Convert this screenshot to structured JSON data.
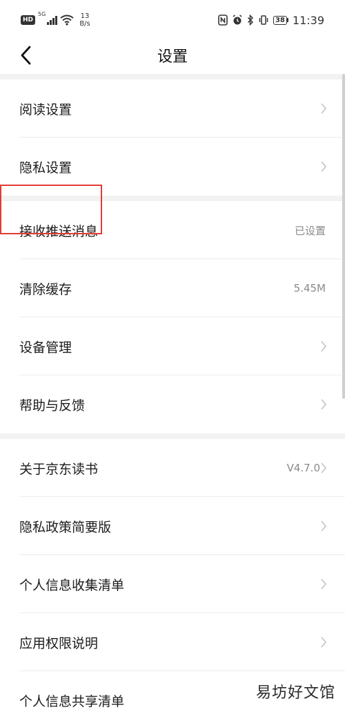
{
  "status_bar": {
    "hd_badge": "HD",
    "signal_label": "5G",
    "net_speed_value": "13",
    "net_speed_unit": "B/s",
    "battery_level": "38",
    "time": "11:39",
    "icons": [
      "nfc-icon",
      "alarm-icon",
      "bluetooth-icon",
      "vibrate-icon",
      "battery-icon"
    ]
  },
  "header": {
    "title": "设置",
    "back_icon": "chevron-left-icon"
  },
  "settings": {
    "groups": [
      {
        "items": [
          {
            "label": "阅读设置",
            "value": "",
            "arrow": true
          },
          {
            "label": "隐私设置",
            "value": "",
            "arrow": true
          }
        ]
      },
      {
        "items": [
          {
            "label": "接收推送消息",
            "value": "已设置",
            "arrow": false
          },
          {
            "label": "清除缓存",
            "value": "5.45M",
            "arrow": false,
            "highlighted": true
          },
          {
            "label": "设备管理",
            "value": "",
            "arrow": true
          },
          {
            "label": "帮助与反馈",
            "value": "",
            "arrow": true
          }
        ]
      },
      {
        "items": [
          {
            "label": "关于京东读书",
            "value": "V4.7.0",
            "arrow": true
          },
          {
            "label": "隐私政策简要版",
            "value": "",
            "arrow": true
          },
          {
            "label": "个人信息收集清单",
            "value": "",
            "arrow": true
          },
          {
            "label": "应用权限说明",
            "value": "",
            "arrow": true
          },
          {
            "label": "个人信息共享清单",
            "value": "",
            "arrow": false
          }
        ]
      }
    ]
  },
  "highlight_color": "#e23b33",
  "watermark": "易坊好文馆"
}
